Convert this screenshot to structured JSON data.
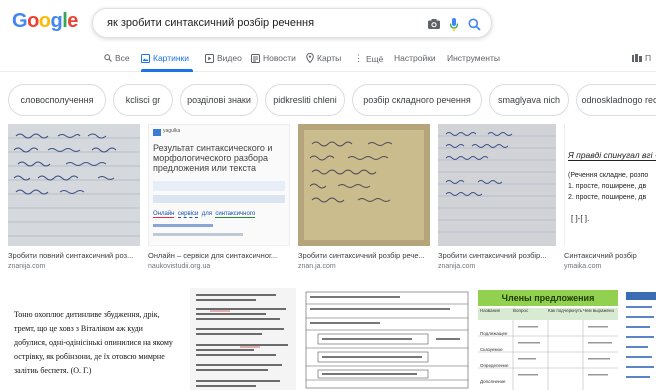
{
  "logo": {
    "letters": [
      "G",
      "o",
      "o",
      "g",
      "l",
      "e"
    ],
    "colors": [
      "#4285f4",
      "#ea4335",
      "#fbbc05",
      "#4285f4",
      "#34a853",
      "#ea4335"
    ]
  },
  "search": {
    "query": "як зробити синтаксичний розбір речення"
  },
  "tabs": [
    {
      "label": "Все",
      "icon": "search-icon"
    },
    {
      "label": "Картинки",
      "icon": "image-icon",
      "active": true
    },
    {
      "label": "Видео",
      "icon": "video-icon"
    },
    {
      "label": "Новости",
      "icon": "news-icon"
    },
    {
      "label": "Карты",
      "icon": "map-pin-icon"
    },
    {
      "label": "Ещё",
      "icon": "more-icon"
    },
    {
      "label": "Настройки"
    },
    {
      "label": "Инструменты"
    }
  ],
  "tab_right_fragment": "П",
  "chips": [
    "словосполучення",
    "kcliscі gr",
    "розділові знаки",
    "pidkreslitі chleni",
    "розбір складного речення",
    "smaglyava nich",
    "odnoskladnogo recher"
  ],
  "results_row1": [
    {
      "caption": "Зробити повний синтаксичний роз...",
      "source": "znanija.com"
    },
    {
      "caption": "Онлайн – сервіси для синтаксичног...",
      "source": "naukovistudii.org.ua"
    },
    {
      "caption": "Зробити синтаксичний розбір рече...",
      "source": "znan.ja.com"
    },
    {
      "caption": "Зробити синтаксичний розбір...",
      "source": "znanija.com"
    },
    {
      "caption": "Синтаксичний розбір",
      "source": "ymaika.com"
    }
  ],
  "thumb2": {
    "site": "yagulka",
    "title_lines": [
      "Результат синтаксического и",
      "морфологического разбора",
      "предложения или текста"
    ],
    "sample_words": [
      "Онлайн",
      "сервіси",
      "для",
      "синтаксичного"
    ]
  },
  "thumb5": {
    "line1": "Я правді спинугал вгі -",
    "lines": [
      "(Речення складне, розпо",
      "1. просте, поширене, дв",
      "2. просте, поширене, дв"
    ],
    "scheme": "[ ]-[ ]."
  },
  "thumb6": {
    "lines": [
      "Тоню охоплює дитинливе збудження, дрік,",
      "тремт, що це ховз з Віталіком аж куди",
      "добулися, одні-одінісінькі опинилися на якому",
      "острівку, як робінзони, де їх отовсю мимрне",
      "залітиь беспетя. (О. Г.)"
    ]
  },
  "thumb9": {
    "title": "Члены предложения",
    "headers": [
      "Название",
      "Вопрос",
      "Как подчеркнуть",
      "Чем выражено"
    ],
    "rows": [
      "Подлежащее",
      "Сказуемое",
      "Определение",
      "Дополнение"
    ]
  }
}
